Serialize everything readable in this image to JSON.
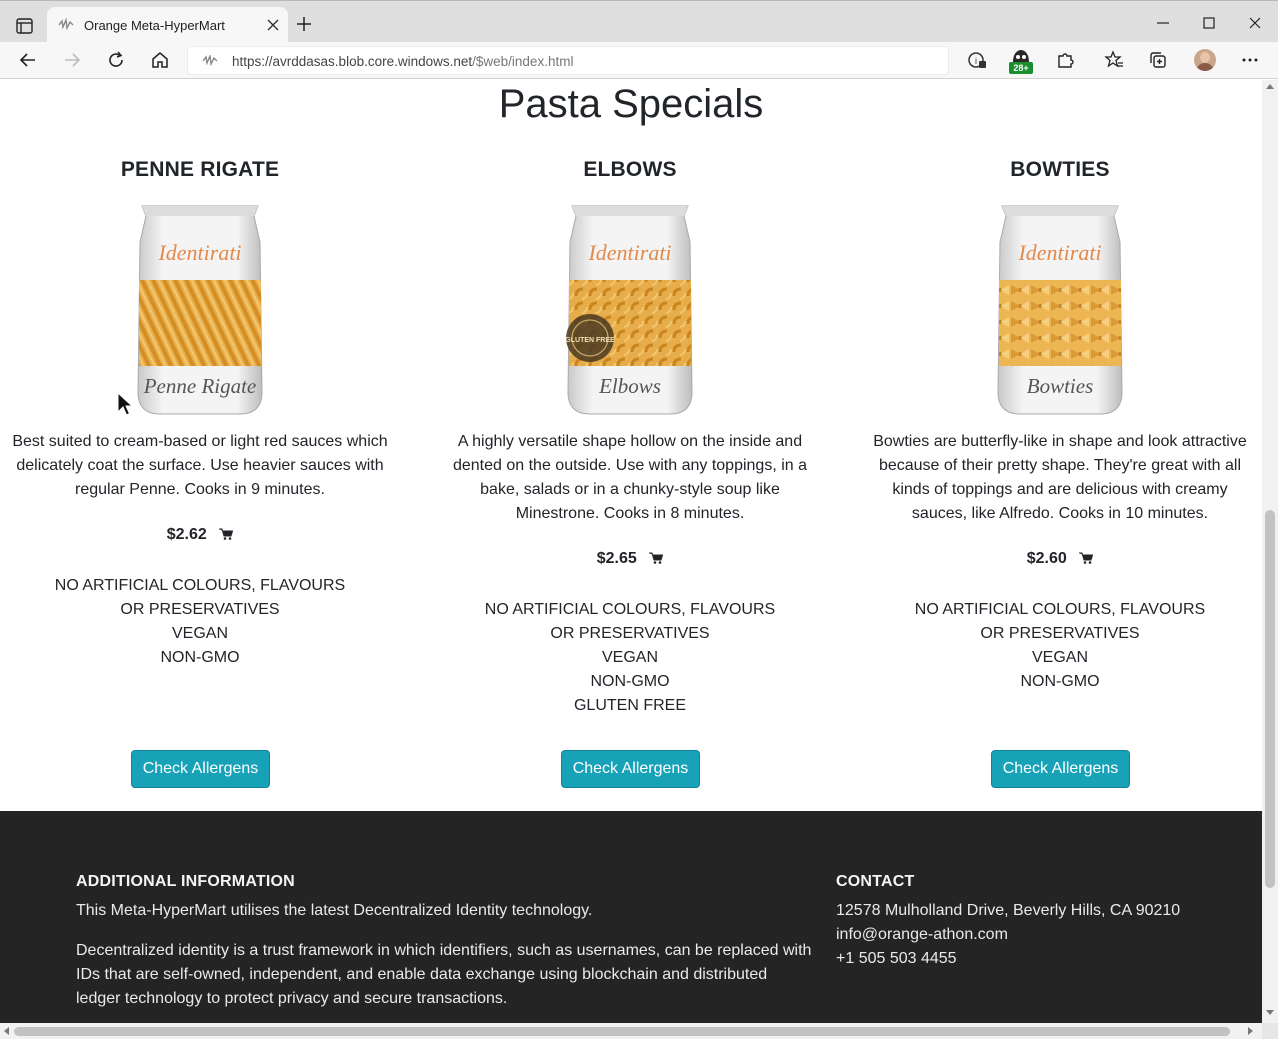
{
  "browser": {
    "tab_title": "Orange Meta-HyperMart",
    "url_host": "https://avrddasas.blob.core.windows.net",
    "url_path": "/$web/index.html",
    "badge_count": "28+"
  },
  "page": {
    "section_title": "Pasta Specials",
    "products": [
      {
        "name": "PENNE RIGATE",
        "brand": "Identirati",
        "label": "Penne Rigate",
        "description": "Best suited to cream-based or light red sauces which delicately coat the surface. Use heavier sauces with regular Penne. Cooks in 9 minutes.",
        "price": "$2.62",
        "tags": [
          "NO ARTIFICIAL COLOURS, FLAVOURS OR PRESERVATIVES",
          "VEGAN",
          "NON-GMO"
        ],
        "button": "Check Allergens"
      },
      {
        "name": "ELBOWS",
        "brand": "Identirati",
        "label": "Elbows",
        "seal": "GLUTEN FREE",
        "description": "A highly versatile shape hollow on the inside and dented on the outside. Use with any toppings, in a bake, salads or in a chunky-style soup like Minestrone. Cooks in 8 minutes.",
        "price": "$2.65",
        "tags": [
          "NO ARTIFICIAL COLOURS, FLAVOURS OR PRESERVATIVES",
          "VEGAN",
          "NON-GMO",
          "GLUTEN FREE"
        ],
        "button": "Check Allergens"
      },
      {
        "name": "BOWTIES",
        "brand": "Identirati",
        "label": "Bowties",
        "description": "Bowties are butterfly-like in shape and look attractive because of their pretty shape. They're great with all kinds of toppings and are delicious with creamy sauces, like Alfredo. Cooks in 10 minutes.",
        "price": "$2.60",
        "tags": [
          "NO ARTIFICIAL COLOURS, FLAVOURS OR PRESERVATIVES",
          "VEGAN",
          "NON-GMO"
        ],
        "button": "Check Allergens"
      }
    ]
  },
  "footer": {
    "info_heading": "ADDITIONAL INFORMATION",
    "info_line1": "This Meta-HyperMart utilises the latest Decentralized Identity technology.",
    "info_line2": "Decentralized identity is a trust framework in which identifiers, such as usernames, can be replaced with IDs that are self-owned, independent, and enable data exchange using blockchain and distributed ledger technology to protect privacy and secure transactions.",
    "contact_heading": "CONTACT",
    "address": "12578 Mulholland Drive, Beverly Hills, CA 90210",
    "email": "info@orange-athon.com",
    "phone": "+1 505 503 4455"
  },
  "colors": {
    "button": "#17a2b8",
    "footer_bg": "#242424",
    "brand_text": "#e28a4a"
  }
}
